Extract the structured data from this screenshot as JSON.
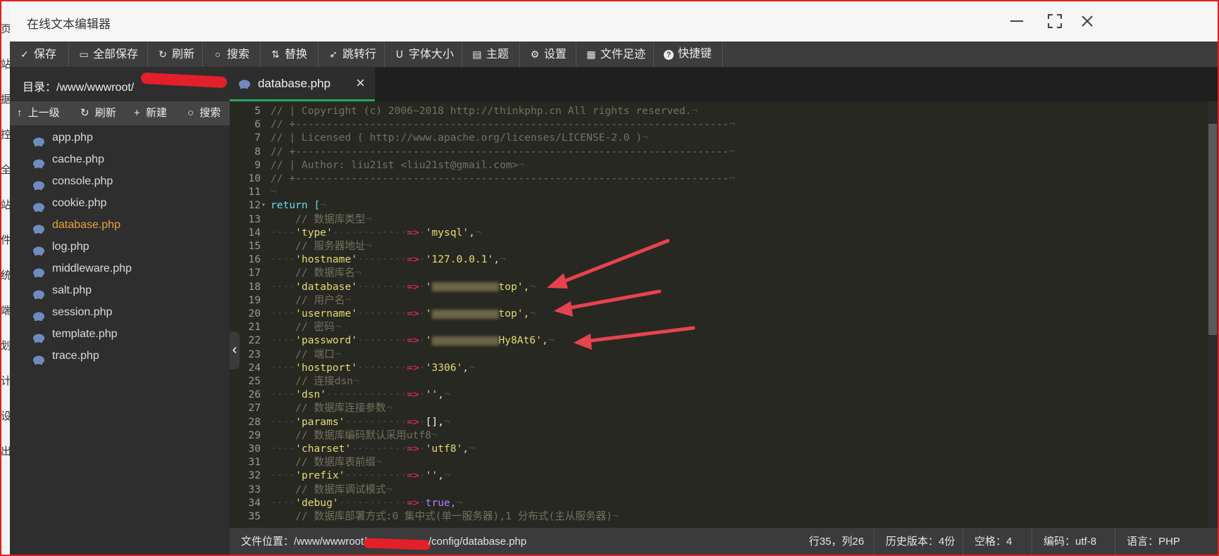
{
  "window": {
    "title": "在线文本编辑器"
  },
  "left_strip_glyphs": [
    "页",
    "站",
    "据",
    "控",
    "全",
    "站",
    "件",
    "统",
    "端",
    "划",
    "计",
    "设",
    "出"
  ],
  "toolbar": [
    {
      "icon": "save-icon",
      "label": "保存"
    },
    {
      "icon": "save-all-icon",
      "label": "全部保存"
    },
    {
      "icon": "refresh-icon",
      "label": "刷新"
    },
    {
      "icon": "search-icon",
      "label": "搜索"
    },
    {
      "icon": "replace-icon",
      "label": "替换"
    },
    {
      "icon": "goto-line-icon",
      "label": "跳转行"
    },
    {
      "icon": "font-size-icon",
      "label": "字体大小"
    },
    {
      "icon": "theme-icon",
      "label": "主题"
    },
    {
      "icon": "settings-icon",
      "label": "设置"
    },
    {
      "icon": "file-history-icon",
      "label": "文件足迹"
    },
    {
      "icon": "help-icon",
      "label": "快捷键"
    }
  ],
  "sidebar": {
    "directory_label": "目录：/www/wwwroot/",
    "tools": [
      {
        "icon": "up-icon",
        "label": "上一级"
      },
      {
        "icon": "refresh-icon",
        "label": "刷新"
      },
      {
        "icon": "plus-icon",
        "label": "新建"
      },
      {
        "icon": "search-icon",
        "label": "搜索"
      }
    ],
    "files": [
      "app.php",
      "cache.php",
      "console.php",
      "cookie.php",
      "database.php",
      "log.php",
      "middleware.php",
      "salt.php",
      "session.php",
      "template.php",
      "trace.php"
    ],
    "active_file": "database.php"
  },
  "editor": {
    "tab": {
      "name": "database.php",
      "close": "×"
    },
    "lines": [
      {
        "n": "5",
        "t": "// | Copyright (c) 2006~2018 http://thinkphp.cn All rights reserved."
      },
      {
        "n": "6",
        "t": "// +----------------------------------------------------------------------"
      },
      {
        "n": "7",
        "t": "// | Licensed ( http://www.apache.org/licenses/LICENSE-2.0 )"
      },
      {
        "n": "8",
        "t": "// +----------------------------------------------------------------------"
      },
      {
        "n": "9",
        "t": "// | Author: liu21st <liu21st@gmail.com>"
      },
      {
        "n": "10",
        "t": "// +----------------------------------------------------------------------"
      },
      {
        "n": "11",
        "t": ""
      },
      {
        "n": "12",
        "t": "return ["
      },
      {
        "n": "13",
        "t": "    // 数据库类型"
      },
      {
        "n": "14",
        "k": "'type'",
        "v": "'mysql',"
      },
      {
        "n": "15",
        "t": "    // 服务器地址"
      },
      {
        "n": "16",
        "k": "'hostname'",
        "v": "'127.0.0.1',"
      },
      {
        "n": "17",
        "t": "    // 数据库名"
      },
      {
        "n": "18",
        "k": "'database'",
        "v": "top',"
      },
      {
        "n": "19",
        "t": "    // 用户名"
      },
      {
        "n": "20",
        "k": "'username'",
        "v": "top',"
      },
      {
        "n": "21",
        "t": "    // 密码"
      },
      {
        "n": "22",
        "k": "'password'",
        "v": "Hy8At6',"
      },
      {
        "n": "23",
        "t": "    // 端口"
      },
      {
        "n": "24",
        "k": "'hostport'",
        "v": "'3306',"
      },
      {
        "n": "25",
        "t": "    // 连接dsn"
      },
      {
        "n": "26",
        "k": "'dsn'",
        "v": "'',"
      },
      {
        "n": "27",
        "t": "    // 数据库连接参数"
      },
      {
        "n": "28",
        "k": "'params'",
        "v": "[],"
      },
      {
        "n": "29",
        "t": "    // 数据库编码默认采用utf8"
      },
      {
        "n": "30",
        "k": "'charset'",
        "v": "'utf8',"
      },
      {
        "n": "31",
        "t": "    // 数据库表前缀"
      },
      {
        "n": "32",
        "k": "'prefix'",
        "v": "'',"
      },
      {
        "n": "33",
        "t": "    // 数据库调试模式"
      },
      {
        "n": "34",
        "k": "'debug'",
        "v": "true,"
      },
      {
        "n": "35",
        "t": "    // 数据库部署方式:0 集中式(单一服务器),1 分布式(主从服务器)"
      }
    ]
  },
  "statusbar": {
    "file_location": "文件位置：/www/wwwroot/",
    "file_location_tail": "/config/database.php",
    "cursor": "行35，列26",
    "history": "历史版本：4份",
    "indent": "空格：4",
    "encoding": "编码：utf-8",
    "language": "语言：PHP"
  },
  "colors": {
    "accent_tab": "#2aa55b",
    "active_file": "#e8a33a",
    "annotation": "#e8424f",
    "redaction": "#e3202a"
  }
}
